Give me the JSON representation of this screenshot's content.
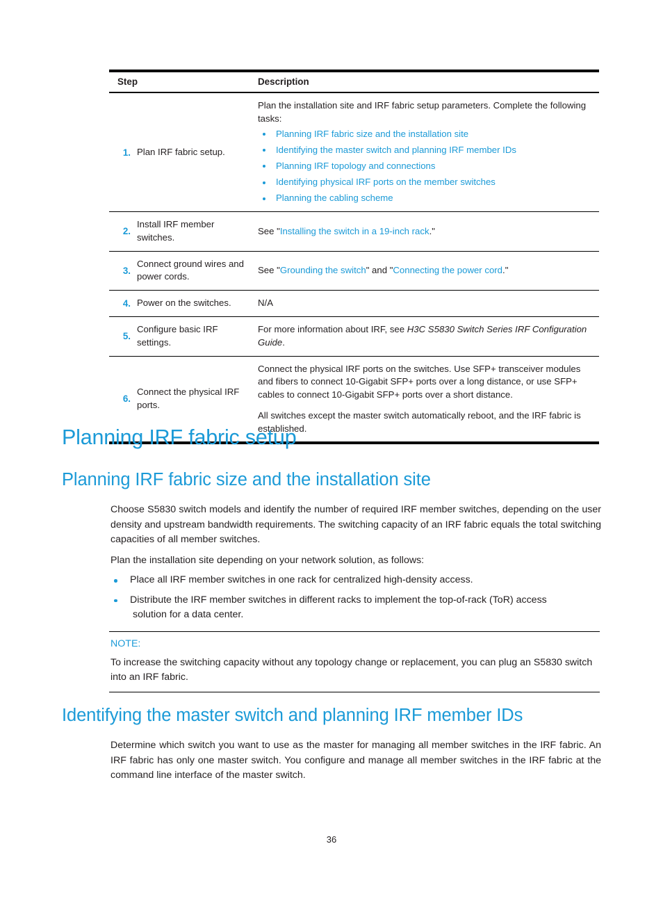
{
  "colors": {
    "accent_blue": "#1b9ad7",
    "text": "#231f20",
    "rule": "#000000"
  },
  "table": {
    "headers": {
      "step": "Step",
      "description": "Description"
    },
    "rows": [
      {
        "num": "1.",
        "action": "Plan IRF fabric setup.",
        "desc_lead": "Plan the installation site and IRF fabric setup parameters. Complete the following tasks:",
        "links": [
          "Planning IRF fabric size and the installation site",
          "Identifying the master switch and planning IRF member IDs",
          "Planning IRF topology and connections",
          "Identifying physical IRF ports on the member switches",
          "Planning the cabling scheme"
        ]
      },
      {
        "num": "2.",
        "action": "Install IRF member switches.",
        "desc_pre": "See \"",
        "desc_link": "Installing the switch in a 19-inch rack",
        "desc_post": ".\""
      },
      {
        "num": "3.",
        "action": "Connect ground wires and power cords.",
        "desc_pre": "See \"",
        "desc_link": "Grounding the switch",
        "desc_mid": "\" and \"",
        "desc_link2": "Connecting the power cord",
        "desc_post": ".\""
      },
      {
        "num": "4.",
        "action": "Power on the switches.",
        "desc_plain": "N/A"
      },
      {
        "num": "5.",
        "action": "Configure basic IRF settings.",
        "desc_pre": "For more information about IRF, see ",
        "desc_italic": "H3C S5830 Switch Series IRF Configuration Guide",
        "desc_post": "."
      },
      {
        "num": "6.",
        "action": "Connect the physical IRF ports.",
        "desc_para1": "Connect the physical IRF ports on the switches. Use SFP+ transceiver modules and fibers to connect 10-Gigabit SFP+ ports over a long distance, or use SFP+ cables to connect 10-Gigabit SFP+ ports over a short distance.",
        "desc_para2": "All switches except the master switch automatically reboot, and the IRF fabric is established."
      }
    ]
  },
  "headings": {
    "h1_planning_irf_fabric_setup": "Planning IRF fabric setup",
    "h2_planning_size": "Planning IRF fabric size and the installation site",
    "h2_identifying_master": "Identifying the master switch and planning IRF member IDs"
  },
  "section_size": {
    "para1": "Choose S5830 switch models and identify the number of required IRF member switches, depending on the user density and upstream bandwidth requirements. The switching capacity of an IRF fabric equals the total switching capacities of all member switches.",
    "para2": "Plan the installation site depending on your network solution, as follows:",
    "bullets": [
      "Place all IRF member switches in one rack for centralized high-density access.",
      "Distribute the IRF member switches in different racks to implement the top-of-rack (ToR) access",
      "solution for a data center."
    ]
  },
  "note": {
    "label": "NOTE:",
    "text": "To increase the switching capacity without any topology change or replacement, you can plug an S5830 switch into an IRF fabric."
  },
  "section_master": {
    "para1": "Determine which switch you want to use as the master for managing all member switches in the IRF fabric. An IRF fabric has only one master switch. You configure and manage all member switches in the IRF fabric at the command line interface of the master switch."
  },
  "footer": {
    "page_number": "36"
  }
}
